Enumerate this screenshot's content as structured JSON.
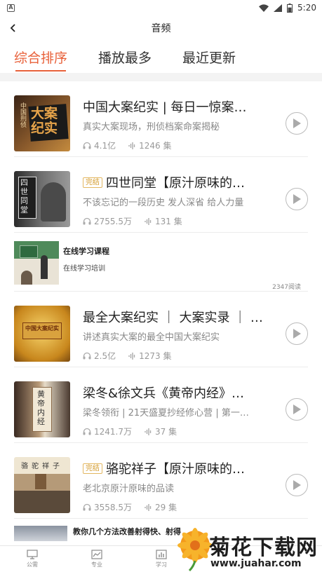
{
  "status_bar": {
    "time": "5:20",
    "app_badge": "A",
    "battery_level": 0.6
  },
  "nav": {
    "title": "音频"
  },
  "tabs": [
    {
      "label": "综合排序",
      "active": true
    },
    {
      "label": "播放最多",
      "active": false
    },
    {
      "label": "最近更新",
      "active": false
    }
  ],
  "items": [
    {
      "title": "中国大案纪实 | 每日一惊案…",
      "badge": "",
      "desc": "真实大案现场，刑侦档案命案揭秘",
      "plays": "4.1亿",
      "episodes": "1246 集",
      "cover_text": "大案纪实"
    },
    {
      "title": "四世同堂【原汁原味的…",
      "badge": "完结",
      "desc": "不该忘记的一段历史 发人深省 给人力量",
      "plays": "2755.5万",
      "episodes": "131 集",
      "cover_text": "四世同堂"
    },
    {
      "title": "最全大案纪实 ｜ 大案实录 ｜ …",
      "badge": "",
      "desc": "讲述真实大案的最全中国大案纪实",
      "plays": "2.5亿",
      "episodes": "1273 集",
      "cover_text": "中国大案纪实"
    },
    {
      "title": "梁冬&徐文兵《黄帝内经》…",
      "badge": "",
      "desc": "梁冬领衔 | 21天盛夏抄经修心营 | 第一…",
      "plays": "1241.7万",
      "episodes": "37 集",
      "cover_text": "黄帝内经"
    },
    {
      "title": "骆驼祥子【原汁原味的…",
      "badge": "完结",
      "desc": "老北京原汁原味的品读",
      "plays": "3558.5万",
      "episodes": "29 集",
      "cover_text": "骆驼祥子"
    }
  ],
  "ad": {
    "title": "在线学习课程",
    "subtitle": "在线学习培训",
    "reads": "2347阅读"
  },
  "partial_item": {
    "title": "教你几个方法改善射得快、射得"
  },
  "bottom_nav": [
    {
      "label": "公需",
      "icon": "monitor-icon"
    },
    {
      "label": "专业",
      "icon": "chart-line-icon"
    },
    {
      "label": "学习",
      "icon": "bar-chart-icon"
    }
  ],
  "watermark": {
    "title": "菊花下载网",
    "url": "www.juahar.com"
  }
}
